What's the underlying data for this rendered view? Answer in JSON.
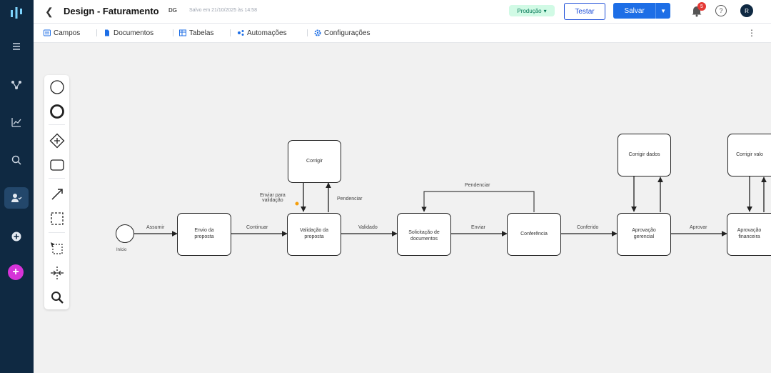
{
  "header": {
    "title": "Design - Faturamento",
    "badge": "DG",
    "saved_text": "Salvo em 21/10/2025 às 14:58",
    "environment": "Produção",
    "test_label": "Testar",
    "save_label": "Salvar",
    "notification_count": "5",
    "help_label": "?",
    "avatar_initial": "R"
  },
  "tabs": [
    {
      "label": "Campos",
      "icon": "fields-icon"
    },
    {
      "label": "Documentos",
      "icon": "document-icon"
    },
    {
      "label": "Tabelas",
      "icon": "table-icon"
    },
    {
      "label": "Automações",
      "icon": "automation-icon"
    },
    {
      "label": "Configurações",
      "icon": "settings-icon"
    }
  ],
  "diagram": {
    "start_label": "Início",
    "tasks": [
      {
        "label": "Envio da\nproposta"
      },
      {
        "label": "Validação da\nproposta"
      },
      {
        "label": "Corrigir"
      },
      {
        "label": "Solicitação de\ndocumentos"
      },
      {
        "label": "Conferência"
      },
      {
        "label": "Aprovação\ngerencial"
      },
      {
        "label": "Corrigir dados"
      },
      {
        "label": "Aprovação\nfinanceira"
      },
      {
        "label": "Corrigir valo"
      }
    ],
    "flows": {
      "assumir": "Assumir",
      "continuar": "Continuar",
      "validado": "Validado",
      "enviar": "Enviar",
      "conferido": "Conferido",
      "aprovar": "Aprovar",
      "pendenciar": "Pendenciar",
      "pendenciar2": "Pendenciar",
      "enviar_validacao": "Enviar para\nvalidação"
    }
  },
  "colors": {
    "nav": "#0f2942",
    "primary": "#1d6ee6",
    "accent": "#d633d8",
    "env_bg": "#d1fae5"
  }
}
